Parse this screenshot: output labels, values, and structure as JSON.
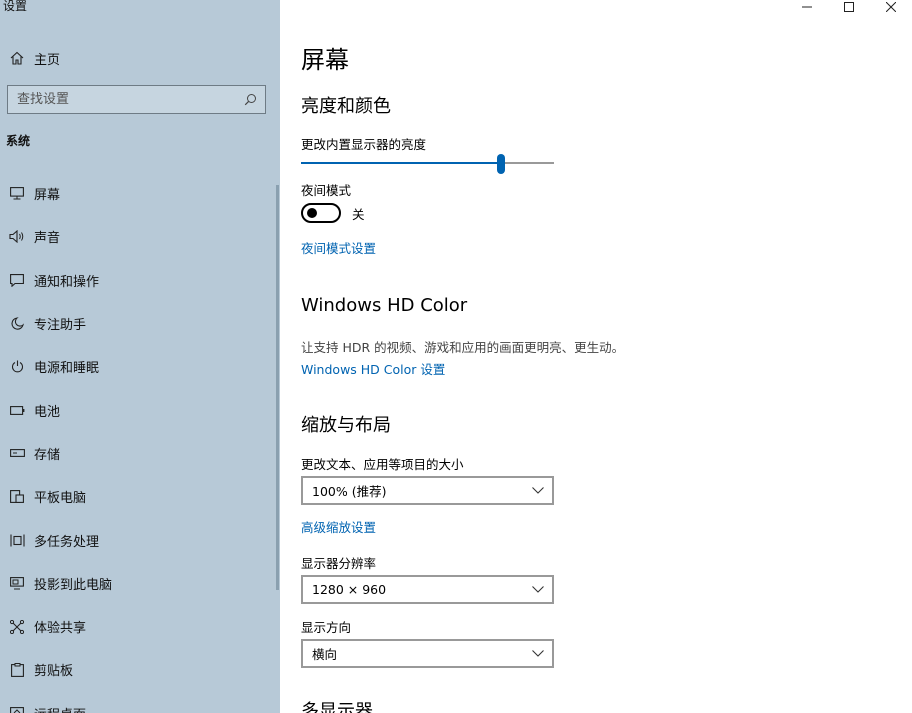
{
  "app_title": "设置",
  "sidebar": {
    "home_label": "主页",
    "search_placeholder": "查找设置",
    "section_title": "系统",
    "items": [
      {
        "label": "屏幕",
        "icon": "monitor-icon"
      },
      {
        "label": "声音",
        "icon": "speaker-icon"
      },
      {
        "label": "通知和操作",
        "icon": "notification-icon"
      },
      {
        "label": "专注助手",
        "icon": "moon-icon"
      },
      {
        "label": "电源和睡眠",
        "icon": "power-icon"
      },
      {
        "label": "电池",
        "icon": "battery-icon"
      },
      {
        "label": "存储",
        "icon": "storage-icon"
      },
      {
        "label": "平板电脑",
        "icon": "tablet-icon"
      },
      {
        "label": "多任务处理",
        "icon": "multitask-icon"
      },
      {
        "label": "投影到此电脑",
        "icon": "project-icon"
      },
      {
        "label": "体验共享",
        "icon": "share-icon"
      },
      {
        "label": "剪贴板",
        "icon": "clipboard-icon"
      },
      {
        "label": "远程桌面",
        "icon": "remote-desktop-icon"
      }
    ]
  },
  "window_controls": [
    "minimize-icon",
    "maximize-icon",
    "close-icon"
  ],
  "main": {
    "title": "屏幕",
    "brightness_color": {
      "heading": "亮度和颜色",
      "brightness_label": "更改内置显示器的亮度",
      "brightness_value": 0.79,
      "night_mode_label": "夜间模式",
      "night_mode_state": "关",
      "night_mode_settings_link": "夜间模式设置"
    },
    "hd_color": {
      "heading": "Windows HD Color",
      "description": "让支持 HDR 的视频、游戏和应用的画面更明亮、更生动。",
      "settings_link": "Windows HD Color 设置"
    },
    "scale_layout": {
      "heading": "缩放与布局",
      "scale_label": "更改文本、应用等项目的大小",
      "scale_value": "100% (推荐)",
      "advanced_link": "高级缩放设置",
      "resolution_label": "显示器分辨率",
      "resolution_value": "1280 × 960",
      "orientation_label": "显示方向",
      "orientation_value": "横向"
    },
    "multi_display_heading": "多显示器"
  },
  "colors": {
    "sidebar_bg": "#b7c9d7",
    "accent": "#0063b1"
  }
}
